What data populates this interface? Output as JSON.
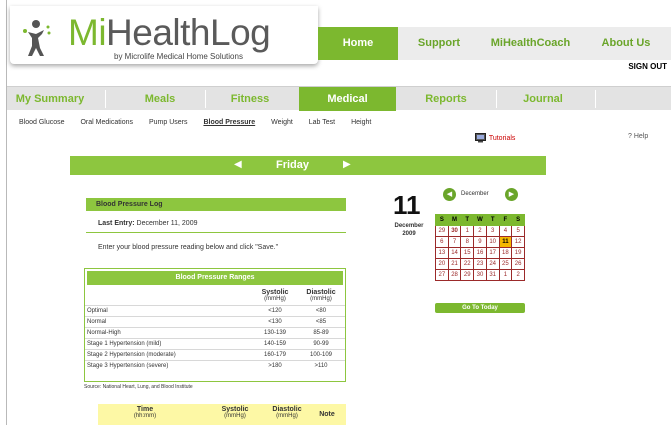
{
  "brand": {
    "mi": "Mi",
    "health_log": "HealthLog",
    "sub": "by Microlife Medical Home Solutions"
  },
  "topnav": [
    "Home",
    "Support",
    "MiHealthCoach",
    "About Us"
  ],
  "signout": "SIGN OUT",
  "tabs": [
    "My Summary",
    "Meals",
    "Fitness",
    "Medical",
    "Reports",
    "Journal"
  ],
  "active_tab": "Medical",
  "subnav": [
    "Blood Glucose",
    "Oral Medications",
    "Pump Users",
    "Blood Pressure",
    "Weight",
    "Lab Test",
    "Height"
  ],
  "active_subnav": "Blood Pressure",
  "tutorials": "Tutorials",
  "help": "? Help",
  "day_bar": {
    "day": "Friday"
  },
  "log": {
    "title": "Blood Pressure Log",
    "last_entry_label": "Last Entry:",
    "last_entry_value": "December 11, 2009",
    "instructions": "Enter your blood pressure reading below and click \"Save.\""
  },
  "ranges": {
    "title": "Blood Pressure Ranges",
    "systolic": "Systolic",
    "diastolic": "Diastolic",
    "unit": "(mmHg)",
    "rows": [
      {
        "label": "Optimal",
        "sys": "<120",
        "dia": "<80"
      },
      {
        "label": "Normal",
        "sys": "<130",
        "dia": "<85"
      },
      {
        "label": "Normal-High",
        "sys": "130-139",
        "dia": "85-89"
      },
      {
        "label": "Stage 1 Hypertension (mild)",
        "sys": "140-159",
        "dia": "90-99"
      },
      {
        "label": "Stage 2 Hypertension (moderate)",
        "sys": "160-179",
        "dia": "100-109"
      },
      {
        "label": "Stage 3 Hypertension (severe)",
        "sys": ">180",
        "dia": ">110"
      }
    ],
    "source": "Source: National Heart, Lung, and Blood Institute"
  },
  "entry_header": {
    "time": "Time",
    "time_unit": "(hh:mm)",
    "systolic": "Systolic",
    "diastolic": "Diastolic",
    "unit": "(mmHg)",
    "note": "Note"
  },
  "date": {
    "day": "11",
    "month": "December",
    "year": "2009"
  },
  "calendar": {
    "month": "December",
    "weekdays": [
      "S",
      "M",
      "T",
      "W",
      "T",
      "F",
      "S"
    ],
    "weeks": [
      [
        "29",
        "30",
        "1",
        "2",
        "3",
        "4",
        "5"
      ],
      [
        "6",
        "7",
        "8",
        "9",
        "10",
        "11",
        "12"
      ],
      [
        "13",
        "14",
        "15",
        "16",
        "17",
        "18",
        "19"
      ],
      [
        "20",
        "21",
        "22",
        "23",
        "24",
        "25",
        "26"
      ],
      [
        "27",
        "28",
        "29",
        "30",
        "31",
        "1",
        "2"
      ]
    ],
    "today": "11",
    "goto_label": "Go To Today"
  },
  "colors": {
    "green": "#7cb82f",
    "today": "#f5b800",
    "entry_header": "#fdf8a5"
  }
}
